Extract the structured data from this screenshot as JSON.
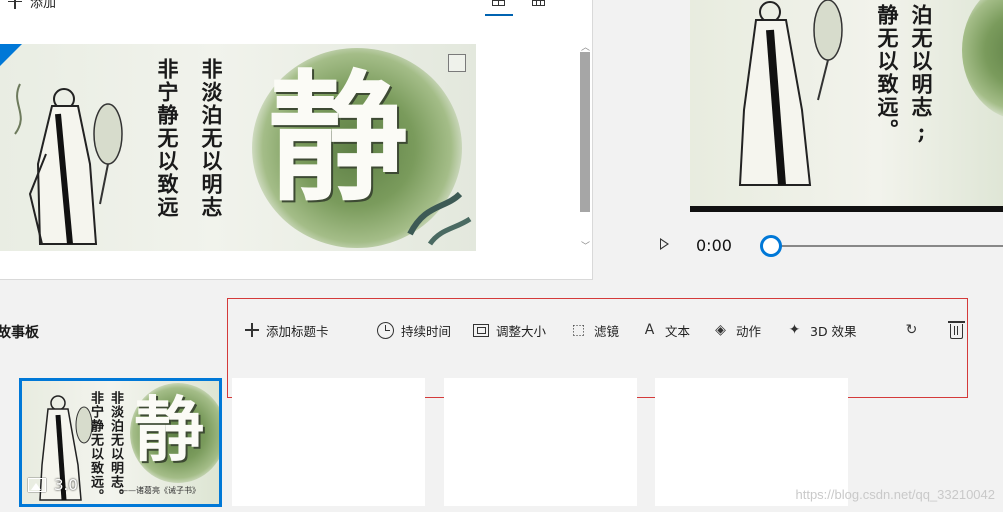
{
  "library": {
    "add_label": "添加",
    "poem_right": "非淡泊无以明志",
    "poem_left": "非宁静无以致远",
    "big_char": "静"
  },
  "preview": {
    "poem_right": "泊无以明志;",
    "poem_left": "静无以致远。",
    "time": "0:00"
  },
  "storyboard": {
    "title": "故事板",
    "toolbar": {
      "add_title_card": "添加标题卡",
      "duration": "持续时间",
      "resize": "调整大小",
      "filters": "滤镜",
      "text": "文本",
      "motion": "动作",
      "effects_3d": "3D 效果"
    },
    "clip": {
      "duration": "3.0",
      "poem_right": "非淡泊无以明志。",
      "poem_left": "非宁静无以致远。",
      "big_char": "静",
      "author": "——诸葛亮《诫子书》"
    }
  },
  "watermark": "https://blog.csdn.net/qq_33210042"
}
